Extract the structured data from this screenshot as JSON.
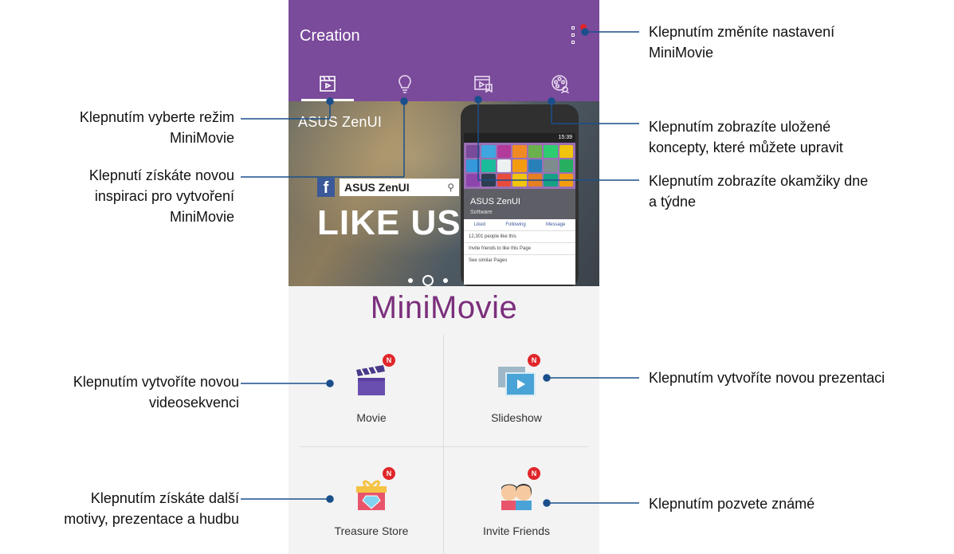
{
  "app": {
    "title": "Creation",
    "tabs": [
      {
        "icon": "clapperboard-icon",
        "active": true
      },
      {
        "icon": "lightbulb-icon",
        "active": false
      },
      {
        "icon": "drafts-icon",
        "active": false
      },
      {
        "icon": "film-reel-icon",
        "active": false
      }
    ],
    "banner": {
      "brand": "ASUS ZenUI",
      "fb_letter": "f",
      "search_text": "ASUS ZenUI",
      "headline": "LIKE US",
      "mini_phone": {
        "time": "15:39",
        "page_name": "ASUS ZenUI",
        "page_category": "Software",
        "actions": [
          "Liked",
          "Following",
          "Message"
        ],
        "lines": [
          "12,301 people like this",
          "Invite friends to like this Page",
          "See similar Pages"
        ]
      }
    },
    "logo": "MiniMovie",
    "grid": [
      {
        "label": "Movie",
        "badge": "N",
        "icon": "clapperboard-icon"
      },
      {
        "label": "Slideshow",
        "badge": "N",
        "icon": "slideshow-icon"
      },
      {
        "label": "Treasure Store",
        "badge": "N",
        "icon": "gift-box-icon"
      },
      {
        "label": "Invite Friends",
        "badge": "N",
        "icon": "friends-icon"
      }
    ]
  },
  "callouts": {
    "settings": [
      "Klepnutím změníte nastavení",
      "MiniMovie"
    ],
    "mode": [
      "Klepnutím vyberte režim",
      "MiniMovie"
    ],
    "inspiration": [
      "Klepnutí získáte novou",
      "inspiraci pro vytvoření",
      "MiniMovie"
    ],
    "drafts": [
      "Klepnutím zobrazíte uložené",
      "koncepty, které můžete upravit"
    ],
    "moments": [
      "Klepnutím zobrazíte okamžiky dne",
      "a týdne"
    ],
    "movie": [
      "Klepnutím vytvoříte novou",
      "videosekvenci"
    ],
    "slideshow": [
      "Klepnutím vytvoříte novou prezentaci"
    ],
    "store": [
      "Klepnutím získáte další",
      "motivy, prezentace a hudbu"
    ],
    "invite": [
      "Klepnutím pozvete známé"
    ]
  },
  "colors": {
    "appbar": "#7a4a9b",
    "logo": "#7b2f7c",
    "badge": "#e0262a",
    "leader": "#1a4f8b"
  }
}
